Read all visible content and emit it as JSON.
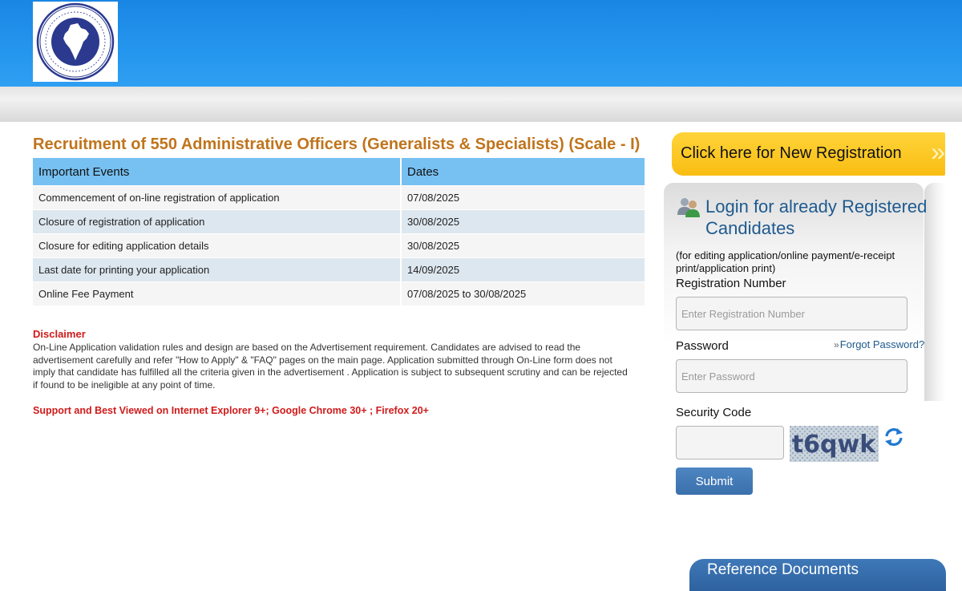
{
  "header": {
    "logo_alt": "The New India Assurance Co. Ltd. logo"
  },
  "main": {
    "title": "Recruitment of 550 Administrative Officers (Generalists & Specialists) (Scale - I)",
    "table": {
      "columns": [
        "Important Events",
        "Dates"
      ],
      "rows": [
        {
          "event": "Commencement of on-line registration of application",
          "date": "07/08/2025"
        },
        {
          "event": "Closure of registration of application",
          "date": "30/08/2025"
        },
        {
          "event": "Closure for editing application details",
          "date": "30/08/2025"
        },
        {
          "event": "Last date for printing your application",
          "date": "14/09/2025"
        },
        {
          "event": "Online Fee Payment",
          "date": "07/08/2025 to 30/08/2025"
        }
      ]
    },
    "disclaimer_title": "Disclaimer",
    "disclaimer_text": "On-Line Application validation rules and design are based on the Advertisement requirement. Candidates are advised to read the advertisement carefully and refer \"How to Apply\" & \"FAQ\" pages on the main page. Application submitted through On-Line form does not imply that candidate has fulfilled all the criteria given in the advertisement . Application is subject to subsequent scrutiny and can be rejected if found to be ineligible at any point of time.",
    "support_note": "Support and Best Viewed on Internet Explorer 9+; Google Chrome 30+ ; Firefox 20+"
  },
  "sidebar": {
    "new_registration_label": "Click here for New Registration",
    "login_heading": "Login for already Registered Candidates",
    "login_subtext": "(for editing application/online payment/e-receipt print/application print)",
    "registration_label": "Registration Number",
    "registration_placeholder": "Enter Registration Number",
    "password_label": "Password",
    "password_placeholder": "Enter Password",
    "forgot_password": "Forgot Password?",
    "security_code_label": "Security Code",
    "captcha_text": "t6qwk",
    "submit_label": "Submit",
    "reference_documents": "Reference Documents"
  },
  "colors": {
    "header_blue": "#2596ee",
    "title_orange": "#c0741c",
    "table_header": "#77c0f2",
    "alert_red": "#d01a1a",
    "registration_yellow": "#f9bd12",
    "link_blue": "#1e5a8e",
    "button_blue": "#3a70ac"
  }
}
